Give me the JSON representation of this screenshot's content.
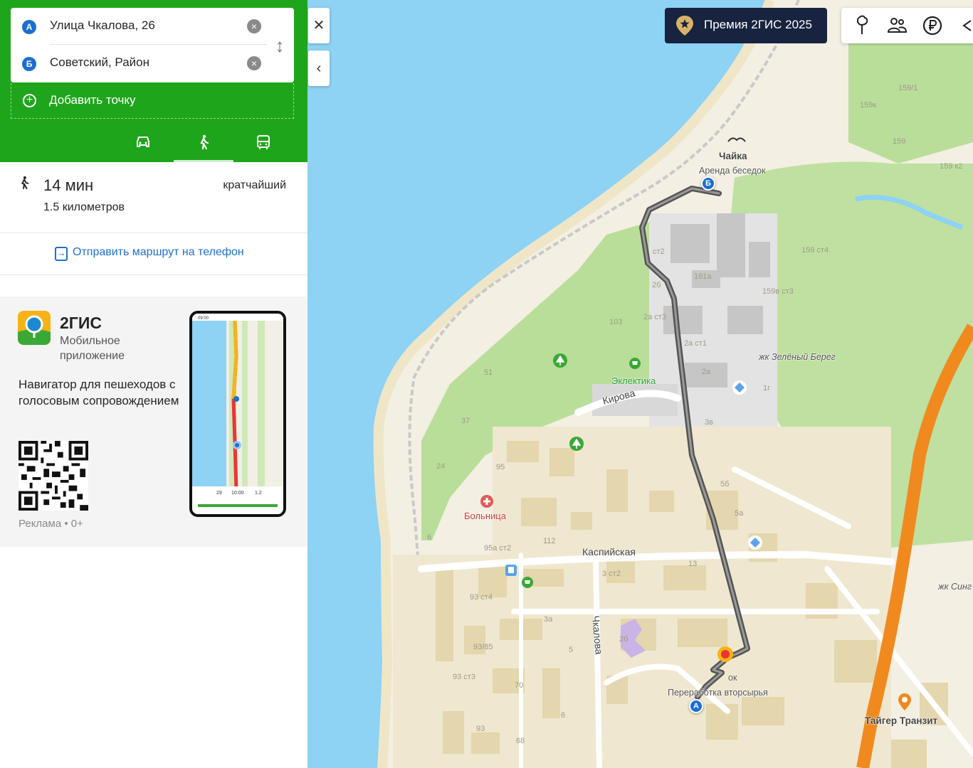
{
  "route": {
    "point_a": {
      "marker": "А",
      "address": "Улица Чкалова, 26"
    },
    "point_b": {
      "marker": "Б",
      "address": "Советский, Район"
    },
    "add_point_label": "Добавить точку",
    "modes": [
      {
        "name": "car",
        "icon": "car-icon",
        "active": false
      },
      {
        "name": "walk",
        "icon": "pedestrian-icon",
        "active": true
      },
      {
        "name": "transit",
        "icon": "bus-icon",
        "active": false
      }
    ],
    "accent_color": "#1fa51b"
  },
  "summary": {
    "duration": "14 мин",
    "distance": "1.5 километров",
    "kind": "кратчайший"
  },
  "send_to_phone_label": "Отправить маршрут на телефон",
  "ad": {
    "title": "2ГИС",
    "subtitle": "Мобильное приложение",
    "text": "Навигатор для пешеходов с голосовым сопровождением",
    "disclaimer": "Реклама • 0+",
    "phone_status": {
      "time": "09:00",
      "stats": [
        "29",
        "10:00",
        "1.2"
      ]
    }
  },
  "map": {
    "premium_label": "Премия 2ГИС 2025",
    "toolbar_icons": [
      "leaf-tree-icon",
      "people-icon",
      "ruble-icon",
      "chevron-icon"
    ],
    "labels": {
      "chaika": "Чайка",
      "arenda": "Аренда беседок",
      "zeleny_bereg": "жк Зелёный Берег",
      "eklektika": "Эклектика",
      "kirova": "Кирова",
      "bolnitsa": "Больница",
      "kaspiyskaya": "Каспийская",
      "chkalova": "Чкалова",
      "pererabotka": "Переработка вторсырья",
      "taiger": "Тайгер Транзит",
      "zhk_sin": "жк Синг",
      "ok": "ок"
    },
    "building_numbers": [
      "159/1",
      "159к",
      "159",
      "159 к2",
      "159 ст4",
      "159в ст3",
      "161а",
      "2а ст3",
      "2а ст1",
      "2а",
      "1г",
      "3в",
      "2б",
      "103",
      "51",
      "37",
      "24",
      "95",
      "6",
      "112",
      "95а ст2",
      "3 ст2",
      "13",
      "93 ст4",
      "93/85",
      "93 ст3",
      "70",
      "68",
      "93",
      "3а",
      "5",
      "6",
      "2б",
      "5б",
      "5а",
      "ст2"
    ],
    "route_color": "#555555",
    "highway_color": "#f08a1e"
  }
}
